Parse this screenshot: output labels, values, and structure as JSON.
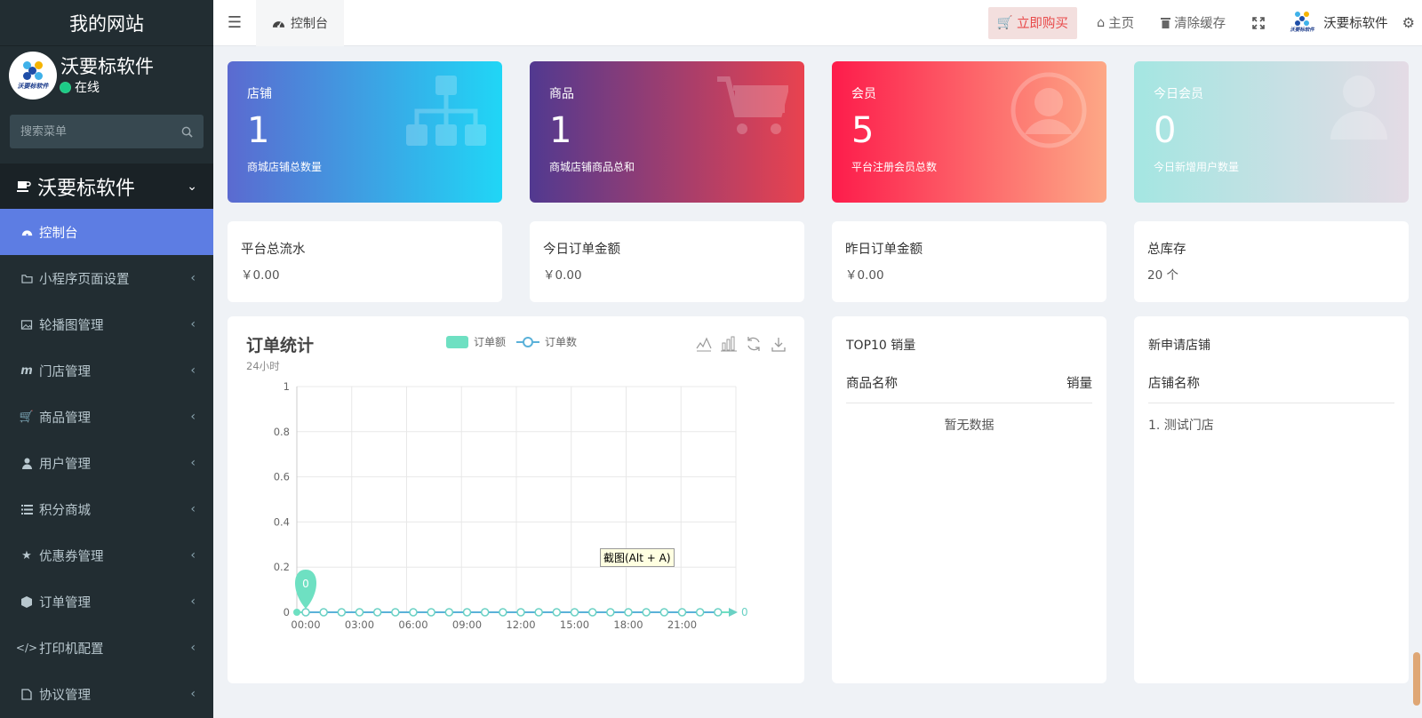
{
  "sidebar": {
    "brand": "我的网站",
    "user_name": "沃要标软件",
    "user_status": "在线",
    "avatar_text": "沃要标软件",
    "search_placeholder": "搜索菜单",
    "group_title": "沃要标软件",
    "items": [
      {
        "label": "控制台",
        "icon": "dashboard-icon",
        "active": true
      },
      {
        "label": "小程序页面设置",
        "icon": "folder-icon"
      },
      {
        "label": "轮播图管理",
        "icon": "image-icon"
      },
      {
        "label": "门店管理",
        "icon": "m-icon"
      },
      {
        "label": "商品管理",
        "icon": "cart-icon"
      },
      {
        "label": "用户管理",
        "icon": "user-icon"
      },
      {
        "label": "积分商城",
        "icon": "list-icon"
      },
      {
        "label": "优惠券管理",
        "icon": "star-icon"
      },
      {
        "label": "订单管理",
        "icon": "cube-icon"
      },
      {
        "label": "打印机配置",
        "icon": "code-icon"
      },
      {
        "label": "协议管理",
        "icon": "document-icon"
      }
    ]
  },
  "header": {
    "tab_label": "控制台",
    "buy_label": "立即购买",
    "home_label": "主页",
    "clear_cache_label": "清除缓存",
    "user_name": "沃要标软件",
    "logo_text": "沃要标软件"
  },
  "stats": [
    {
      "label": "店铺",
      "value": "1",
      "sub": "商城店铺总数量",
      "icon": "sitemap-icon"
    },
    {
      "label": "商品",
      "value": "1",
      "sub": "商城店铺商品总和",
      "icon": "cart-icon"
    },
    {
      "label": "会员",
      "value": "5",
      "sub": "平台注册会员总数",
      "icon": "user-circle-icon"
    },
    {
      "label": "今日会员",
      "value": "0",
      "sub": "今日新增用户数量",
      "icon": "user-icon"
    }
  ],
  "infos": [
    {
      "title": "平台总流水",
      "value": "￥0.00"
    },
    {
      "title": "今日订单金额",
      "value": "￥0.00"
    },
    {
      "title": "昨日订单金额",
      "value": "￥0.00"
    },
    {
      "title": "总库存",
      "value": "20 个"
    }
  ],
  "chart": {
    "title": "订单统计",
    "subtitle": "24小时",
    "legend_amount": "订单额",
    "legend_count": "订单数",
    "tooltip": "截图(Alt + A)"
  },
  "chart_data": {
    "type": "line",
    "title": "订单统计",
    "subtitle": "24小时",
    "x": [
      "00:00",
      "01:00",
      "02:00",
      "03:00",
      "04:00",
      "05:00",
      "06:00",
      "07:00",
      "08:00",
      "09:00",
      "10:00",
      "11:00",
      "12:00",
      "13:00",
      "14:00",
      "15:00",
      "16:00",
      "17:00",
      "18:00",
      "19:00",
      "20:00",
      "21:00",
      "22:00",
      "23:00"
    ],
    "x_tick_labels": [
      "00:00",
      "03:00",
      "06:00",
      "09:00",
      "12:00",
      "15:00",
      "18:00",
      "21:00"
    ],
    "series": [
      {
        "name": "订单额",
        "values": [
          0,
          0,
          0,
          0,
          0,
          0,
          0,
          0,
          0,
          0,
          0,
          0,
          0,
          0,
          0,
          0,
          0,
          0,
          0,
          0,
          0,
          0,
          0,
          0
        ],
        "color": "#6ee0c2"
      },
      {
        "name": "订单数",
        "values": [
          0,
          0,
          0,
          0,
          0,
          0,
          0,
          0,
          0,
          0,
          0,
          0,
          0,
          0,
          0,
          0,
          0,
          0,
          0,
          0,
          0,
          0,
          0,
          0
        ],
        "color": "#5ab1d9"
      }
    ],
    "ylim": [
      0,
      1
    ],
    "y_ticks": [
      "0",
      "0.2",
      "0.4",
      "0.6",
      "0.8",
      "1"
    ],
    "markpoint_label": "0",
    "end_label": "0",
    "grid": true
  },
  "top10": {
    "title": "TOP10 销量",
    "col_name": "商品名称",
    "col_sales": "销量",
    "empty": "暂无数据"
  },
  "new_stores": {
    "title": "新申请店铺",
    "col_name": "店铺名称",
    "rows": [
      "1. 测试门店"
    ]
  },
  "colors": {
    "sidebar_bg": "#222d32",
    "active_menu": "#5d7de3",
    "card1": [
      "#5a6fd1",
      "#21d4f6"
    ],
    "card2": [
      "#4b3a8e",
      "#e84255"
    ],
    "card3": [
      "#fd1f4d",
      "#fda07f"
    ],
    "card4": [
      "#a8e7e2",
      "#e2dde4"
    ]
  }
}
